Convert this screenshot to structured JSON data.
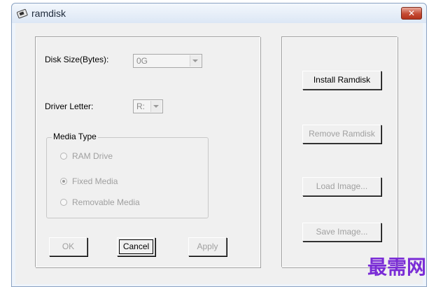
{
  "window": {
    "title": "ramdisk",
    "close_glyph": "✕",
    "app_icon": "ramdisk-app-icon"
  },
  "form": {
    "disk_size_label": "Disk Size(Bytes):",
    "disk_size_value": "0G",
    "driver_letter_label": "Driver Letter:",
    "driver_letter_value": "R:",
    "media_type": {
      "title": "Media Type",
      "options": [
        {
          "label": "RAM Drive",
          "selected": false
        },
        {
          "label": "Fixed Media",
          "selected": true
        },
        {
          "label": "Removable Media",
          "selected": false
        }
      ]
    }
  },
  "buttons": {
    "ok": "OK",
    "cancel": "Cancel",
    "apply": "Apply",
    "install": "Install Ramdisk",
    "remove": "Remove Ramdisk",
    "load": "Load Image...",
    "save": "Save Image..."
  },
  "watermark": "最需网"
}
